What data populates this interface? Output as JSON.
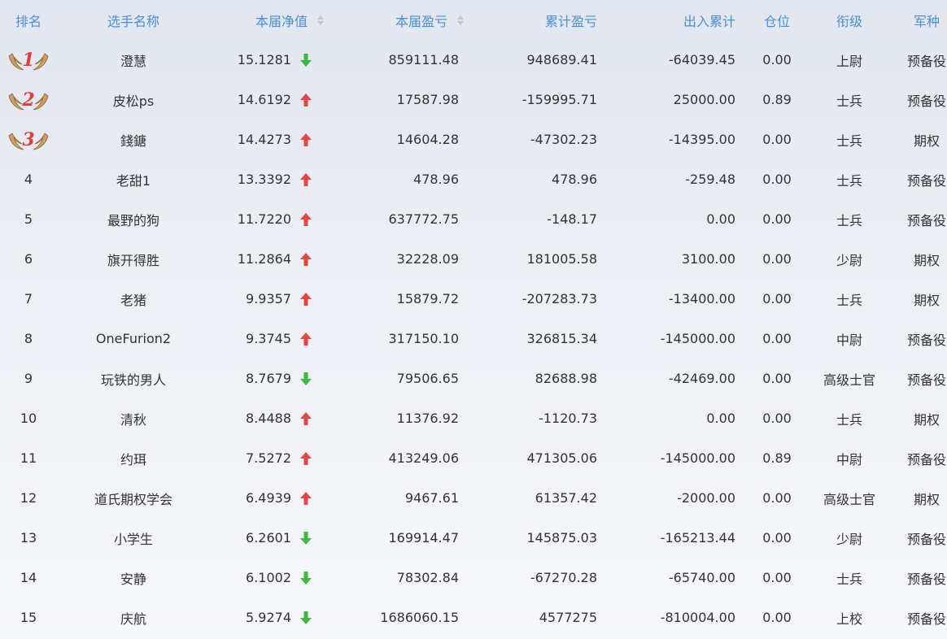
{
  "headers": {
    "rank": "排名",
    "name": "选手名称",
    "nav": "本届净值",
    "pl": "本届盈亏",
    "cum": "累计盈亏",
    "flow": "出入累计",
    "pos": "仓位",
    "level": "衔级",
    "type": "军种"
  },
  "colors": {
    "header_text": "#4a90d9",
    "up_arrow": "#e64545",
    "down_arrow": "#3db93d",
    "medal_number": "#e23b3b"
  },
  "rows": [
    {
      "rank": "1",
      "medal": true,
      "name": "澄慧",
      "nav": "15.1281",
      "trend": "down",
      "pl": "859111.48",
      "cum": "948689.41",
      "flow": "-64039.45",
      "pos": "0.00",
      "level": "上尉",
      "type": "预备役"
    },
    {
      "rank": "2",
      "medal": true,
      "name": "皮松ps",
      "nav": "14.6192",
      "trend": "up",
      "pl": "17587.98",
      "cum": "-159995.71",
      "flow": "25000.00",
      "pos": "0.89",
      "level": "士兵",
      "type": "预备役"
    },
    {
      "rank": "3",
      "medal": true,
      "name": "錢鎕",
      "nav": "14.4273",
      "trend": "up",
      "pl": "14604.28",
      "cum": "-47302.23",
      "flow": "-14395.00",
      "pos": "0.00",
      "level": "士兵",
      "type": "期权"
    },
    {
      "rank": "4",
      "medal": false,
      "name": "老甜1",
      "nav": "13.3392",
      "trend": "up",
      "pl": "478.96",
      "cum": "478.96",
      "flow": "-259.48",
      "pos": "0.00",
      "level": "士兵",
      "type": "预备役"
    },
    {
      "rank": "5",
      "medal": false,
      "name": "最野的狗",
      "nav": "11.7220",
      "trend": "up",
      "pl": "637772.75",
      "cum": "-148.17",
      "flow": "0.00",
      "pos": "0.00",
      "level": "士兵",
      "type": "预备役"
    },
    {
      "rank": "6",
      "medal": false,
      "name": "旗开得胜",
      "nav": "11.2864",
      "trend": "up",
      "pl": "32228.09",
      "cum": "181005.58",
      "flow": "3100.00",
      "pos": "0.00",
      "level": "少尉",
      "type": "期权"
    },
    {
      "rank": "7",
      "medal": false,
      "name": "老猪",
      "nav": "9.9357",
      "trend": "up",
      "pl": "15879.72",
      "cum": "-207283.73",
      "flow": "-13400.00",
      "pos": "0.00",
      "level": "士兵",
      "type": "期权"
    },
    {
      "rank": "8",
      "medal": false,
      "name": "OneFurion2",
      "nav": "9.3745",
      "trend": "up",
      "pl": "317150.10",
      "cum": "326815.34",
      "flow": "-145000.00",
      "pos": "0.00",
      "level": "中尉",
      "type": "预备役"
    },
    {
      "rank": "9",
      "medal": false,
      "name": "玩铁的男人",
      "nav": "8.7679",
      "trend": "down",
      "pl": "79506.65",
      "cum": "82688.98",
      "flow": "-42469.00",
      "pos": "0.00",
      "level": "高级士官",
      "type": "预备役"
    },
    {
      "rank": "10",
      "medal": false,
      "name": "清秋",
      "nav": "8.4488",
      "trend": "up",
      "pl": "11376.92",
      "cum": "-1120.73",
      "flow": "0.00",
      "pos": "0.00",
      "level": "士兵",
      "type": "期权"
    },
    {
      "rank": "11",
      "medal": false,
      "name": "约珥",
      "nav": "7.5272",
      "trend": "up",
      "pl": "413249.06",
      "cum": "471305.06",
      "flow": "-145000.00",
      "pos": "0.89",
      "level": "中尉",
      "type": "预备役"
    },
    {
      "rank": "12",
      "medal": false,
      "name": "道氏期权学会",
      "nav": "6.4939",
      "trend": "up",
      "pl": "9467.61",
      "cum": "61357.42",
      "flow": "-2000.00",
      "pos": "0.00",
      "level": "高级士官",
      "type": "期权"
    },
    {
      "rank": "13",
      "medal": false,
      "name": "小学生",
      "nav": "6.2601",
      "trend": "down",
      "pl": "169914.47",
      "cum": "145875.03",
      "flow": "-165213.44",
      "pos": "0.00",
      "level": "少尉",
      "type": "预备役"
    },
    {
      "rank": "14",
      "medal": false,
      "name": "安静",
      "nav": "6.1002",
      "trend": "down",
      "pl": "78302.84",
      "cum": "-67270.28",
      "flow": "-65740.00",
      "pos": "0.00",
      "level": "士兵",
      "type": "预备役"
    },
    {
      "rank": "15",
      "medal": false,
      "name": "庆航",
      "nav": "5.9274",
      "trend": "down",
      "pl": "1686060.15",
      "cum": "4577275",
      "flow": "-810004.00",
      "pos": "0.00",
      "level": "上校",
      "type": "预备役"
    }
  ]
}
